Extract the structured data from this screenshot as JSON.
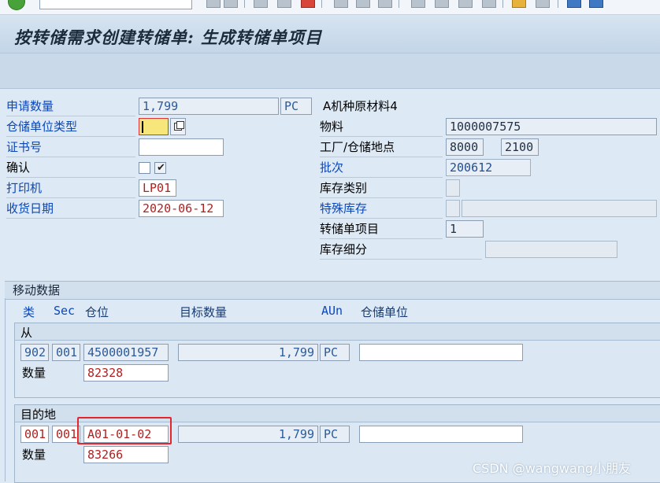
{
  "header": {
    "title": "按转储需求创建转储单: 生成转储单项目"
  },
  "left_form": {
    "req_qty": {
      "label": "申请数量",
      "value": "1,799",
      "unit": "PC"
    },
    "storage_type": {
      "label": "仓储单位类型",
      "value": ""
    },
    "certificate": {
      "label": "证书号",
      "value": ""
    },
    "confirm": {
      "label": "确认"
    },
    "printer": {
      "label": "打印机",
      "value": "LP01"
    },
    "gr_date": {
      "label": "收货日期",
      "value": "2020-06-12"
    }
  },
  "right_form": {
    "material_desc": "A机种原材料4",
    "material": {
      "label": "物料",
      "value": "1000007575"
    },
    "plant": {
      "label": "工厂/仓储地点",
      "plant": "8000",
      "sloc": "2100"
    },
    "batch": {
      "label": "批次",
      "value": "200612"
    },
    "stock_cat": {
      "label": "库存类别",
      "value": ""
    },
    "special_stock": {
      "label": "特殊库存",
      "value": "",
      "desc": ""
    },
    "to_item": {
      "label": "转储单项目",
      "value": "1"
    },
    "stock_sub": {
      "label": "库存细分",
      "value": ""
    }
  },
  "movement": {
    "title": "移动数据",
    "columns": {
      "type": "类",
      "sec": "Sec",
      "bin": "仓位",
      "target_qty": "目标数量",
      "aun": "AUn",
      "su": "仓储单位"
    },
    "from": {
      "title": "从",
      "type": "902",
      "sec": "001",
      "bin": "4500001957",
      "target_qty": "1,799",
      "aun": "PC",
      "su": "",
      "qty_label": "数量",
      "qty": "82328"
    },
    "dest": {
      "title": "目的地",
      "type": "001",
      "sec": "001",
      "bin": "A01-01-02",
      "target_qty": "1,799",
      "aun": "PC",
      "su": "",
      "qty_label": "数量",
      "qty": "83266"
    }
  },
  "watermark": "CSDN @wangwang小朋友",
  "colors": {
    "link": "#0c47b8",
    "highlight": "#e2262b",
    "editable_text": "#b02020"
  }
}
